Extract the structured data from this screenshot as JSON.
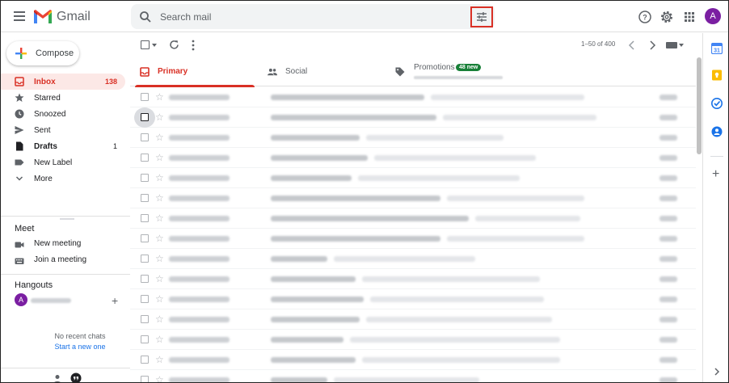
{
  "app": {
    "name": "Gmail",
    "avatar_initial": "A"
  },
  "search": {
    "placeholder": "Search mail"
  },
  "sidebar": {
    "compose_label": "Compose",
    "items": [
      {
        "label": "Inbox",
        "count": "138",
        "icon": "inbox-icon",
        "active": true
      },
      {
        "label": "Starred",
        "count": "",
        "icon": "star-icon"
      },
      {
        "label": "Snoozed",
        "count": "",
        "icon": "clock-icon"
      },
      {
        "label": "Sent",
        "count": "",
        "icon": "send-icon"
      },
      {
        "label": "Drafts",
        "count": "1",
        "icon": "draft-icon"
      },
      {
        "label": "New Label",
        "count": "",
        "icon": "label-icon"
      },
      {
        "label": "More",
        "count": "",
        "icon": "chevron-down-icon"
      }
    ],
    "meet": {
      "title": "Meet",
      "new_meeting": "New meeting",
      "join_meeting": "Join a meeting"
    },
    "hangouts": {
      "title": "Hangouts",
      "user_initial": "A",
      "no_chats": "No recent chats",
      "start_new": "Start a new one"
    }
  },
  "toolbar": {
    "range": "1–50 of 400"
  },
  "tabs": [
    {
      "label": "Primary",
      "icon": "inbox-icon",
      "active": true
    },
    {
      "label": "Social",
      "icon": "people-icon"
    },
    {
      "label": "Promotions",
      "icon": "tag-icon",
      "badge": "48 new"
    }
  ],
  "colors": {
    "accent": "#d93025",
    "primary_blue": "#1a73e8",
    "badge_green": "#188038"
  },
  "emails_visible_count": 15
}
